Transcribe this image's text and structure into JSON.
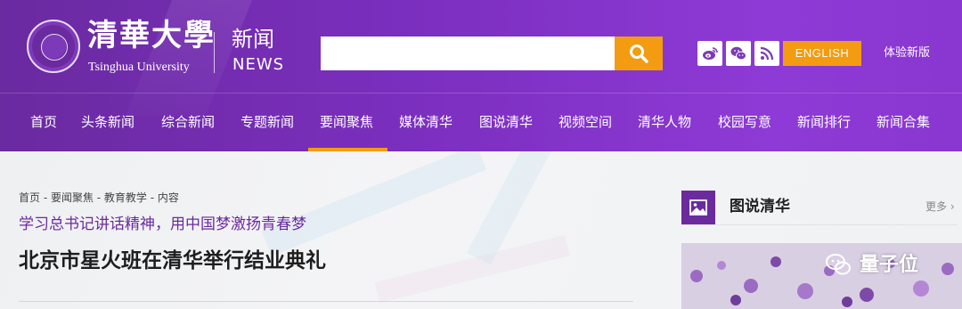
{
  "header": {
    "logo_cn": "清華大學",
    "logo_en": "Tsinghua University",
    "section_cn": "新闻",
    "section_en": "NEWS",
    "search": {
      "value": "",
      "placeholder": ""
    },
    "search_icon": "search-icon",
    "social_icons": [
      "weibo-icon",
      "wechat-icon",
      "rss-icon"
    ],
    "english_label": "ENGLISH",
    "trial_label": "体验新版",
    "accent_color": "#f39c12",
    "brand_color": "#6b2a9e"
  },
  "nav": {
    "items": [
      {
        "label": "首页"
      },
      {
        "label": "头条新闻"
      },
      {
        "label": "综合新闻"
      },
      {
        "label": "专题新闻"
      },
      {
        "label": "要闻聚焦"
      },
      {
        "label": "媒体清华"
      },
      {
        "label": "图说清华"
      },
      {
        "label": "视频空间"
      },
      {
        "label": "清华人物"
      },
      {
        "label": "校园写意"
      },
      {
        "label": "新闻排行"
      },
      {
        "label": "新闻合集"
      }
    ],
    "active_label": "要闻聚焦"
  },
  "article": {
    "breadcrumb": "首页 - 要闻聚焦 - 教育教学 - 内容",
    "subtitle": "学习总书记讲话精神，用中国梦激扬青春梦",
    "title": "北京市星火班在清华举行结业典礼"
  },
  "sidebar": {
    "icon": "image-icon",
    "title": "图说清华",
    "more": "更多 ›"
  },
  "watermark": {
    "icon": "wechat-icon",
    "text": "量子位"
  }
}
